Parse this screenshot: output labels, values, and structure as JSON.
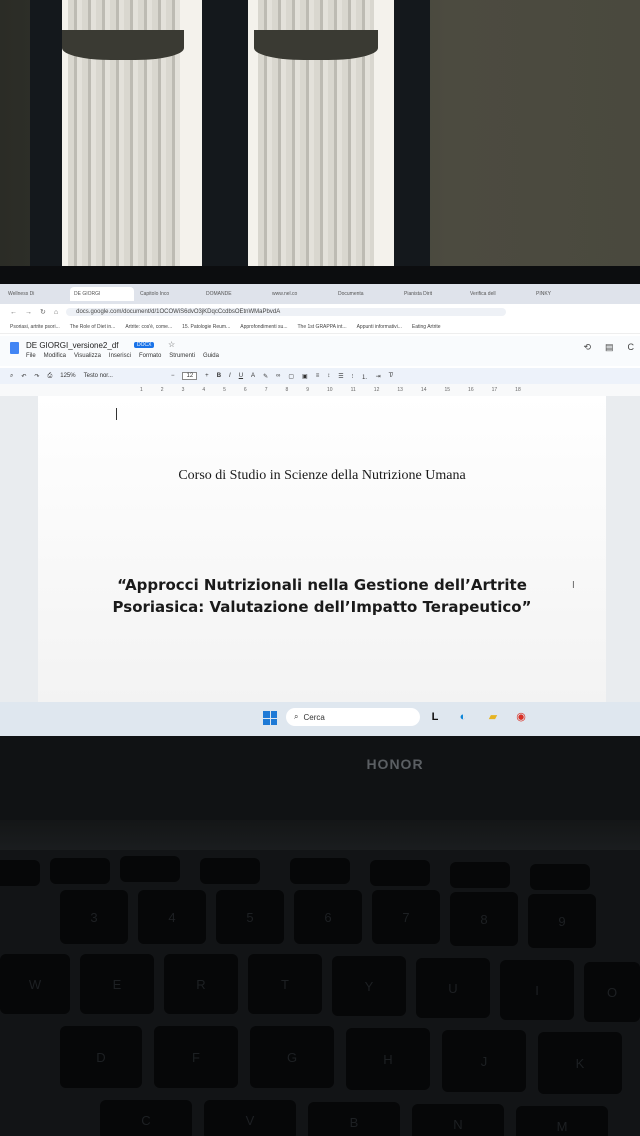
{
  "browser": {
    "tabs": [
      "Wellness Di",
      "DE GIORGI",
      "Capitolo Inco",
      "DOMANDE",
      "www.nel.co",
      "Documenta",
      "Pianista Dirit",
      "Verifica dell",
      "PINKY"
    ],
    "url": "docs.google.com/document/d/1OCOWiS6dvO3jKDqcCcdbsOEtnWMaPbvdA",
    "bookmarks": [
      "Psoriasi, artrite psori...",
      "The Role of Diet in...",
      "Artrite: cos'è, come...",
      "15. Patologie Reum...",
      "Approfondimenti su...",
      "The 1st GRAPPA int...",
      "Appunti informativi...",
      "Eating Artrite"
    ]
  },
  "doc": {
    "title": "DE GIORGI_versione2_df",
    "badge": "DOCX",
    "menus": [
      "File",
      "Modifica",
      "Visualizza",
      "Inserisci",
      "Formato",
      "Strumenti",
      "Guida"
    ],
    "zoom": "125%",
    "style": "Testo nor...",
    "font_size": "12",
    "ruler": [
      "1",
      "2",
      "3",
      "4",
      "5",
      "6",
      "7",
      "8",
      "9",
      "10",
      "11",
      "12",
      "13",
      "14",
      "15",
      "16",
      "17",
      "18"
    ],
    "course": "Corso di Studio in Scienze della Nutrizione Umana",
    "title_line1": "“Approcci Nutrizionali nella Gestione dell’Artrite",
    "title_line2": "Psoriasica: Valutazione dell’Impatto Terapeutico”"
  },
  "taskbar": {
    "search_placeholder": "Cerca"
  },
  "laptop": {
    "brand": "HONOR"
  },
  "keyboard": {
    "row1": [
      "3",
      "4",
      "5",
      "6",
      "7",
      "8",
      "9"
    ],
    "row2": [
      "W",
      "E",
      "R",
      "T",
      "Y",
      "U",
      "I",
      "O"
    ],
    "row3": [
      "D",
      "F",
      "G",
      "H",
      "J",
      "K"
    ],
    "row4": [
      "C",
      "V",
      "B",
      "N",
      "M"
    ]
  }
}
